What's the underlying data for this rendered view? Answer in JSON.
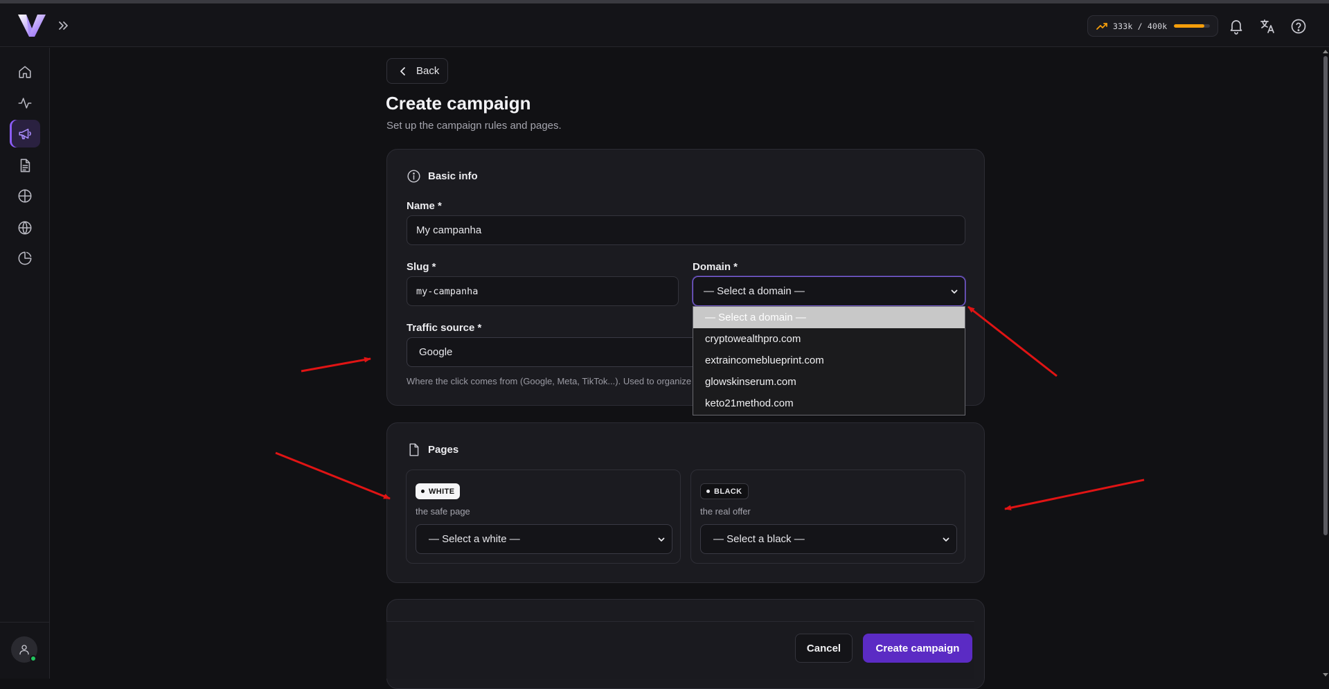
{
  "header": {
    "usage": {
      "text": "333k / 400k",
      "used": 333,
      "limit": 400,
      "fraction": 0.8325
    },
    "icons": [
      "logo-icon",
      "expand-icon",
      "trending-up-icon",
      "bell-icon",
      "translate-icon",
      "help-icon"
    ]
  },
  "sidebar": {
    "items": [
      {
        "name": "home-icon",
        "active": false
      },
      {
        "name": "activity-icon",
        "active": false
      },
      {
        "name": "megaphone-icon",
        "active": true
      },
      {
        "name": "file-text-icon",
        "active": false
      },
      {
        "name": "crosshair-globe-icon",
        "active": false
      },
      {
        "name": "globe-icon",
        "active": false
      },
      {
        "name": "pie-chart-icon",
        "active": false
      }
    ],
    "avatar": "user-icon"
  },
  "page": {
    "back_label": "Back",
    "title": "Create campaign",
    "subtitle": "Set up the campaign rules and pages."
  },
  "basic_info": {
    "heading": "Basic info",
    "name_label": "Name *",
    "name_value": "My campanha",
    "slug_label": "Slug *",
    "slug_value": "my-campanha",
    "domain_label": "Domain *",
    "domain_value": "— Select a domain —",
    "traffic_label": "Traffic source *",
    "traffic_value": "Google",
    "traffic_hint": "Where the click comes from (Google, Meta, TikTok...). Used to organize"
  },
  "domain_dropdown": {
    "options": [
      "— Select a domain —",
      "cryptowealthpro.com",
      "extraincomeblueprint.com",
      "glowskinserum.com",
      "keto21method.com"
    ],
    "selected_index": 0
  },
  "pages": {
    "heading": "Pages",
    "white": {
      "badge": "WHITE",
      "desc": "the safe page",
      "select": "— Select a white —"
    },
    "black": {
      "badge": "BLACK",
      "desc": "the real offer",
      "select": "— Select a black —"
    }
  },
  "footer": {
    "cancel_label": "Cancel",
    "create_label": "Create campaign"
  },
  "colors": {
    "accent": "#5b2bc4",
    "usage_bar": "#f59e0b",
    "annotation_arrows": "#e01414",
    "online": "#22c55e"
  }
}
